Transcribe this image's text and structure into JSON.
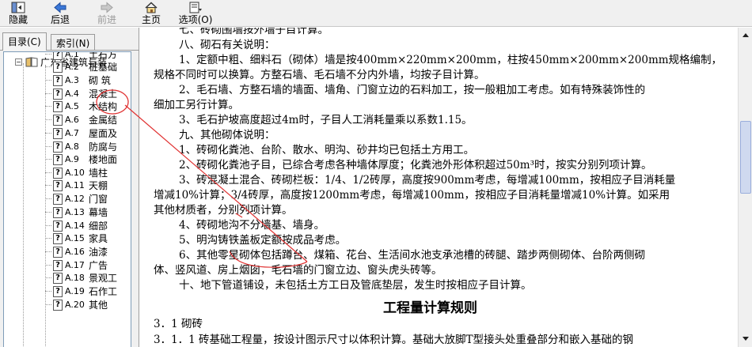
{
  "toolbar": {
    "items": [
      {
        "label": "隐藏",
        "icon": "hide-icon",
        "enabled": true
      },
      {
        "label": "后退",
        "icon": "back-arrow-icon",
        "enabled": true
      },
      {
        "label": "前进",
        "icon": "forward-arrow-icon",
        "enabled": false
      },
      {
        "label": "主页",
        "icon": "home-icon",
        "enabled": true
      },
      {
        "label": "选项(O)",
        "icon": "options-icon",
        "enabled": true
      }
    ]
  },
  "left": {
    "tabs": [
      {
        "label": "目录(C)"
      },
      {
        "label": "索引(N)"
      }
    ],
    "tree_root": "广东省建筑与装",
    "tree_items": [
      {
        "code": "A.1",
        "text": "土石方"
      },
      {
        "code": "A.2",
        "text": "桩基础"
      },
      {
        "code": "A.3",
        "text": "砌  筑"
      },
      {
        "code": "A.4",
        "text": "混凝土"
      },
      {
        "code": "A.5",
        "text": "木结构"
      },
      {
        "code": "A.6",
        "text": "金属结"
      },
      {
        "code": "A.7",
        "text": "屋面及"
      },
      {
        "code": "A.8",
        "text": "防腐与"
      },
      {
        "code": "A.9",
        "text": "楼地面"
      },
      {
        "code": "A.10",
        "text": "墙柱"
      },
      {
        "code": "A.11",
        "text": "天棚"
      },
      {
        "code": "A.12",
        "text": "门窗"
      },
      {
        "code": "A.13",
        "text": "幕墙"
      },
      {
        "code": "A.14",
        "text": "细部"
      },
      {
        "code": "A.15",
        "text": "家具"
      },
      {
        "code": "A.16",
        "text": "油漆"
      },
      {
        "code": "A.17",
        "text": "广告"
      },
      {
        "code": "A.18",
        "text": "景观工"
      },
      {
        "code": "A.19",
        "text": "石作工"
      },
      {
        "code": "A.20",
        "text": "其他"
      }
    ]
  },
  "content": {
    "lines": [
      "七、砖砌围墙按外墙子目计算。",
      "八、砌石有关说明：",
      "1、定额中粗、细料石（砌体）墙是按400mm×220mm×200mm，柱按450mm×200mm×200mm规格编制，",
      "规格不同时可以换算。方整石墙、毛石墙不分内外墙，均按子目计算。",
      "2、毛石墙、方整石墙的墙面、墙角、门窗立边的石料加工，按一般粗加工考虑。如有特殊装饰性的",
      "细加工另行计算。",
      "3、毛石护坡高度超过4m时，子目人工消耗量乘以系数1.15。",
      "九、其他砌体说明：",
      "1、砖砌化粪池、台阶、散水、明沟、砂井均已包括土方用工。",
      "2、砖砌化粪池子目，已综合考虑各种墙体厚度；化粪池外形体积超过50m³时，按实分别列项计算。",
      "3、砖混凝土混合、砖砌栏板：1/4、1/2砖厚，高度按900mm考虑，每增减100mm，按相应子目消耗量",
      "增减10%计算；3/4砖厚，高度按1200mm考虑，每增减100mm，按相应子目消耗量增减10%计算。如采用",
      "其他材质者，分别列项计算。",
      "4、砖砌地沟不分墙基、墙身。",
      "5、明沟铸铁盖板定额按成品考虑。",
      "6、其他零星砌体包括蹲台、煤箱、花台、生活间水池支承池槽的砖腿、踏步两侧砌体、台阶两侧砌",
      "体、竖风道、房上烟囱，毛石墙的门窗立边、窗头虎头砖等。",
      "十、地下管道铺设，未包括土方工日及管底垫层，发生时按相应子目计算。"
    ],
    "heading": "工程量计算规则",
    "section_lines": [
      "3．1   砌砖",
      "3．1．1   砖基础工程量，按设计图示尺寸以体积计算。基础大放脚T型接头处重叠部分和嵌入基础的钢"
    ]
  },
  "colors": {
    "annotation": "#e03030",
    "scroll_thumb": "#cfd9ef"
  }
}
